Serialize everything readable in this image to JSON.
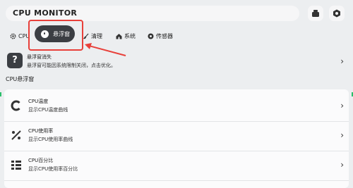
{
  "header": {
    "title": "CPU MONITOR"
  },
  "tabs": [
    {
      "label": "CPU",
      "icon": "gear-icon"
    },
    {
      "label": "悬浮窗",
      "icon": "floating-window-icon",
      "active": true
    },
    {
      "label": "清理",
      "icon": "broom-icon"
    },
    {
      "label": "系统",
      "icon": "home-icon"
    },
    {
      "label": "传感器",
      "icon": "sensor-icon"
    }
  ],
  "notice": {
    "title": "悬浮窗消失",
    "subtitle": "悬浮窗可能因系统限制关闭，点击优化。",
    "icon": "question-icon"
  },
  "section": {
    "label": "CPU悬浮窗"
  },
  "items": [
    {
      "title": "CPU温度",
      "subtitle": "显示CPU温度曲线",
      "icon": "temperature-gauge-icon"
    },
    {
      "title": "CPU使用率",
      "subtitle": "显示CPU使用率曲线",
      "icon": "usage-chart-icon"
    },
    {
      "title": "CPU百分比",
      "subtitle": "显示CPU使用率百分比",
      "icon": "percent-list-icon"
    }
  ],
  "colors": {
    "accent_green": "#2bbf6a",
    "highlight_red": "#e8403a",
    "active_tab_bg": "#3b3e43"
  }
}
